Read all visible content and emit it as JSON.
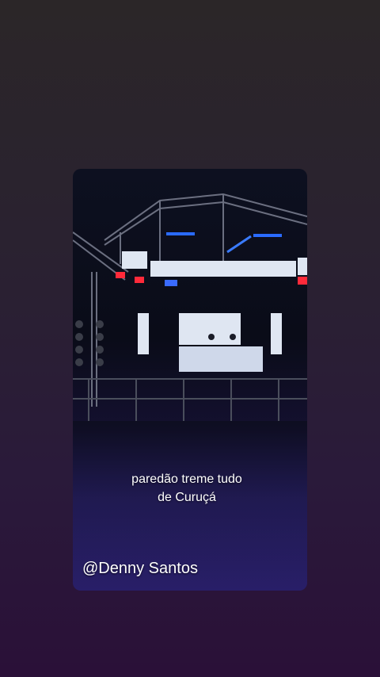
{
  "story": {
    "caption_line1": "paredão treme tudo",
    "caption_line2": "de Curuçá",
    "watermark": "@Denny Santos"
  },
  "colors": {
    "page_background_top": "#2b2628",
    "page_background_bottom": "#2a1038",
    "stage_light_red": "#ff2a3a",
    "stage_light_blue": "#2a6bff",
    "led_panel": "#dfe6f2"
  }
}
